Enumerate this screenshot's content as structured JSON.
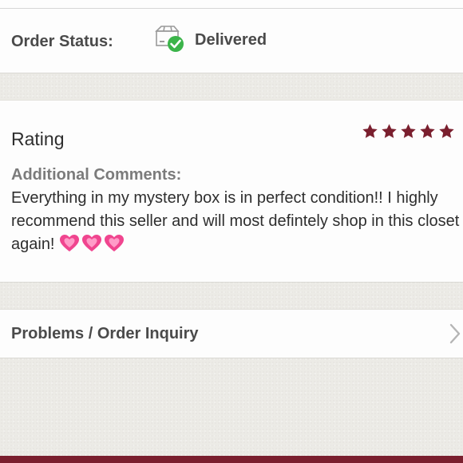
{
  "order_status": {
    "label": "Order Status:",
    "value": "Delivered",
    "icon": "delivered-box-check-icon",
    "icon_check_color": "#3bb44a"
  },
  "rating": {
    "title": "Rating",
    "stars": 5,
    "max_stars": 5,
    "star_color": "#7a1f2e",
    "comments_label": "Additional Comments:",
    "comments_text": "Everything in my mystery box is in perfect condition!! I highly recommend this seller and will most defintely shop in this closet again!",
    "emoji_hearts": 3
  },
  "inquiry": {
    "label": "Problems / Order Inquiry"
  },
  "colors": {
    "brand": "#7a1f2e",
    "text_dark": "#2e2e2e",
    "text_medium": "#4a4a4a",
    "text_muted": "#7b7b7b",
    "heart": "#f0458f"
  }
}
